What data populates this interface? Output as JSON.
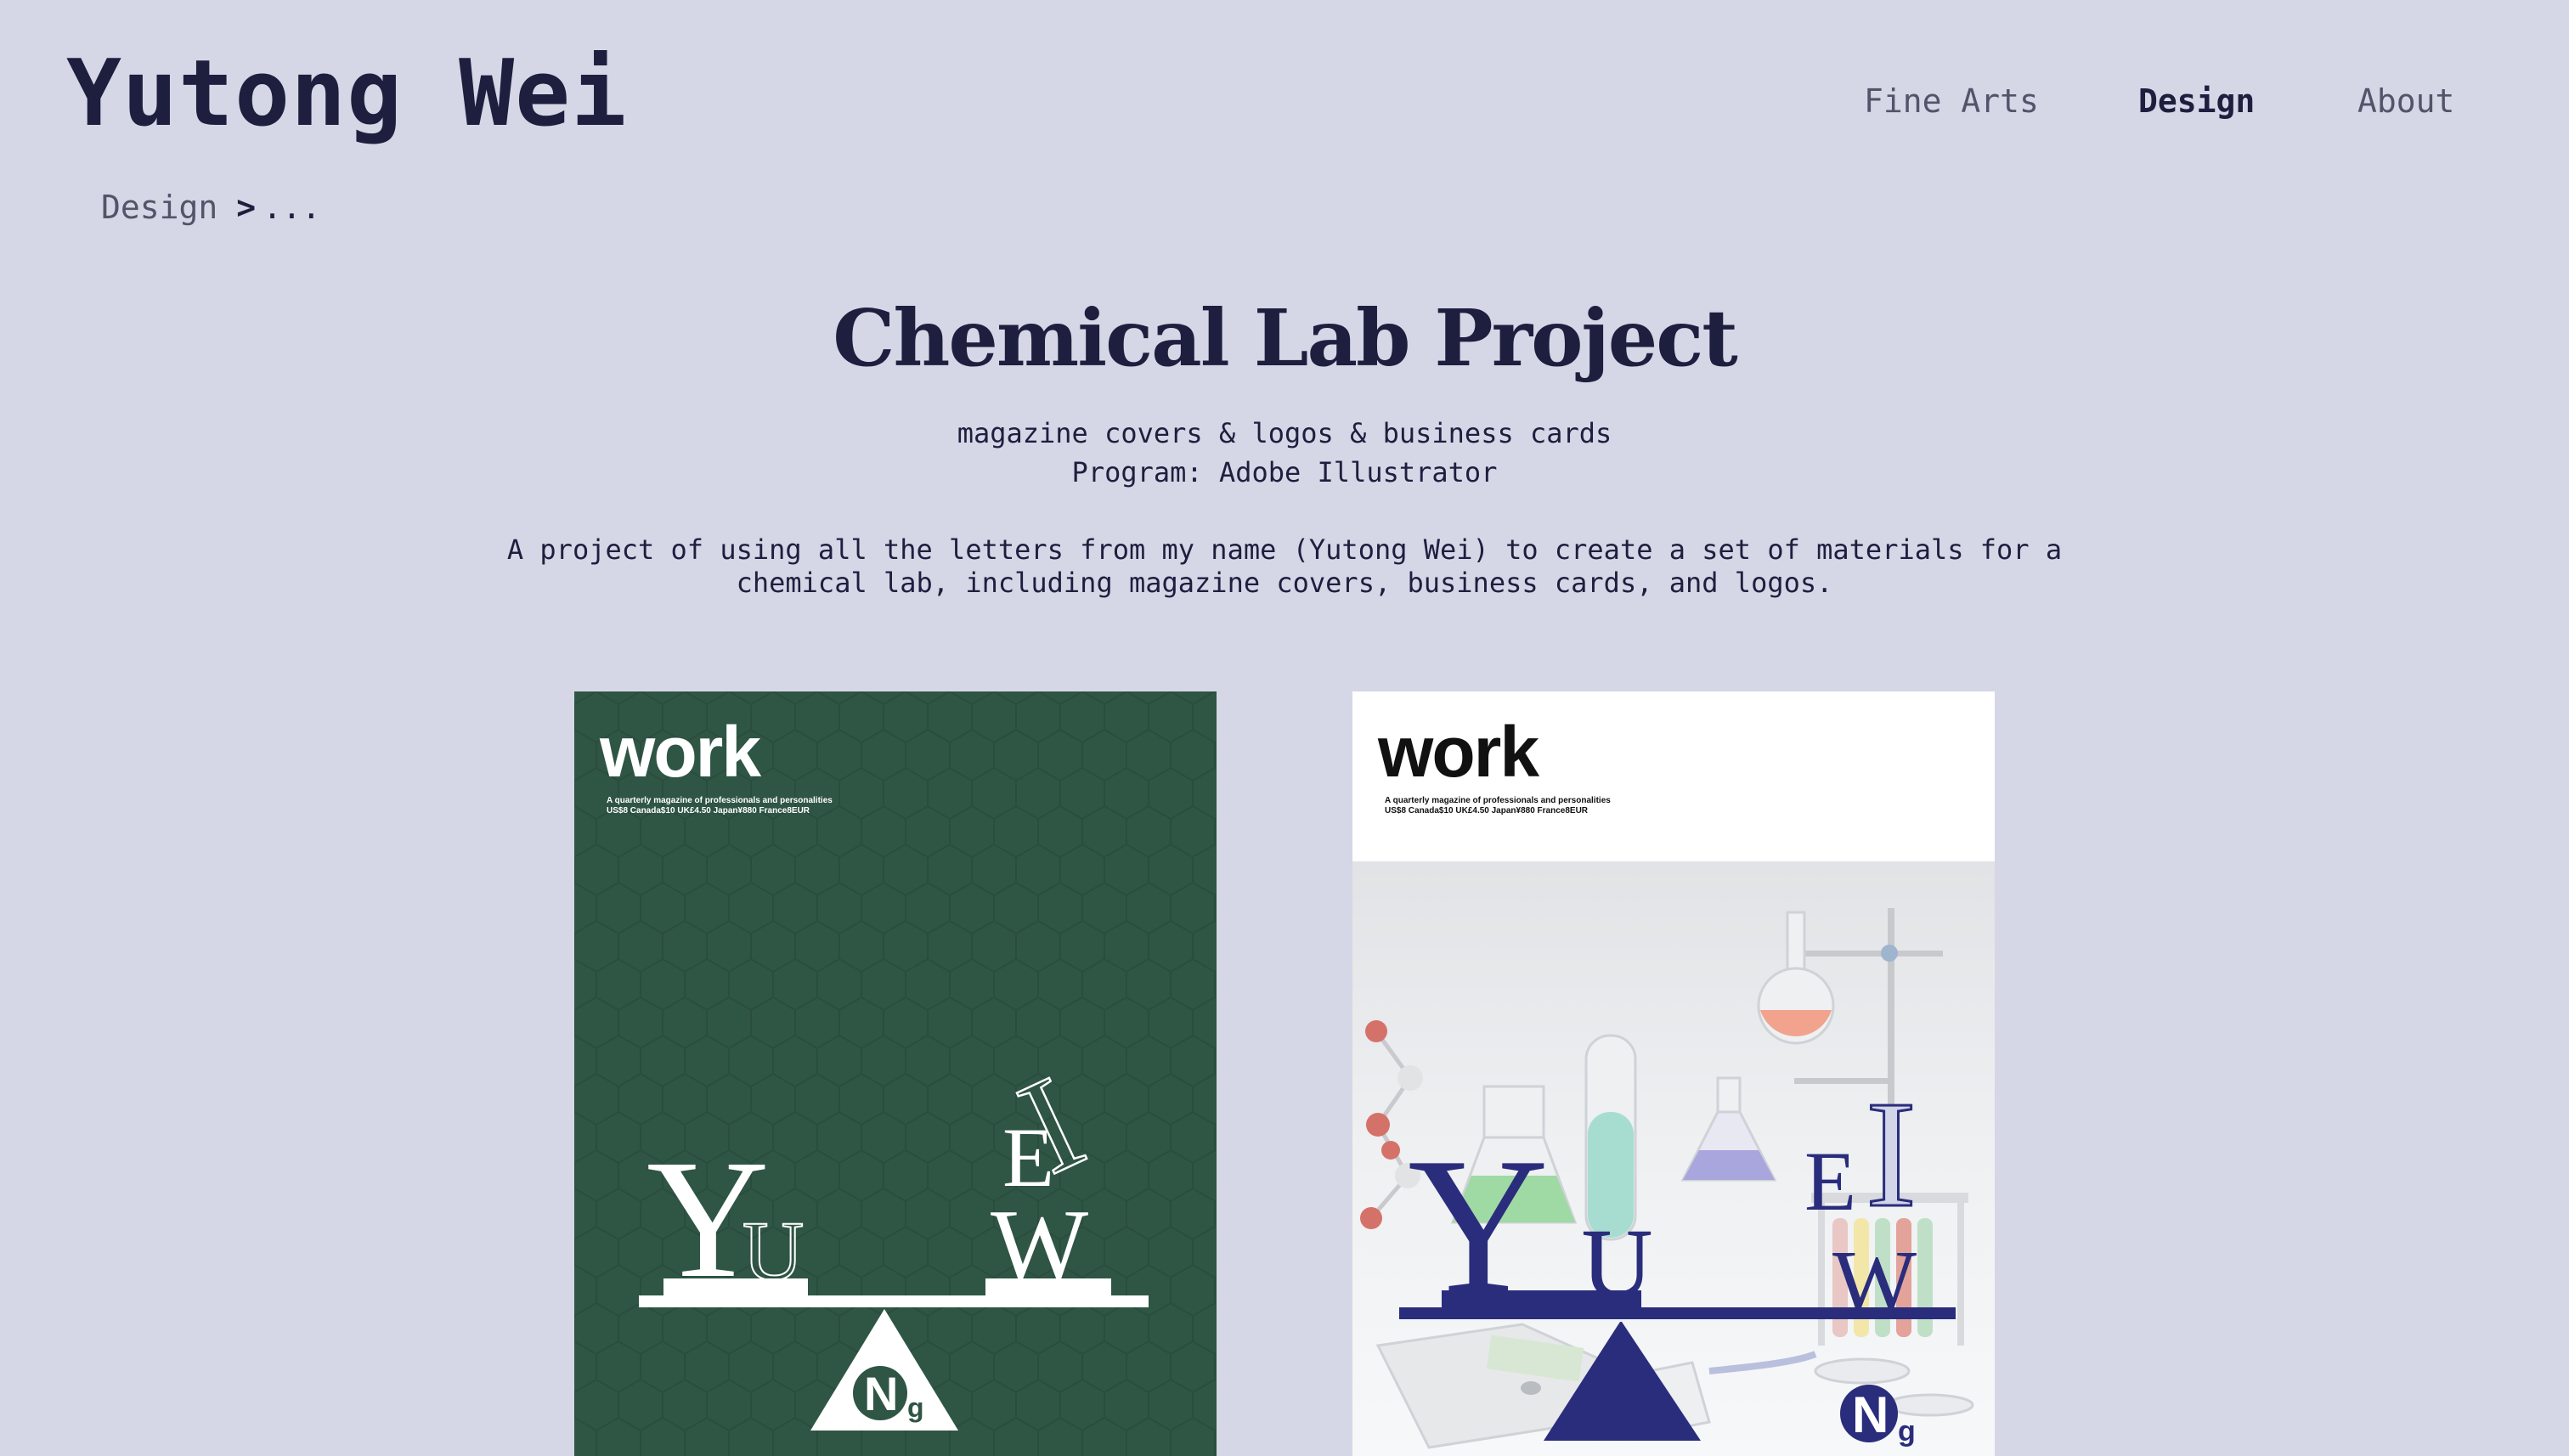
{
  "site": {
    "title": "Yutong Wei"
  },
  "nav": {
    "items": [
      {
        "label": "Fine Arts",
        "active": false
      },
      {
        "label": "Design",
        "active": true
      },
      {
        "label": "About",
        "active": false
      }
    ]
  },
  "breadcrumb": {
    "root": "Design",
    "separator": ">",
    "rest": "..."
  },
  "project": {
    "title": "Chemical Lab Project",
    "subtitle": "magazine covers & logos & business cards",
    "program": "Program: Adobe Illustrator",
    "description": "A project of using all the letters from my name (Yutong Wei) to create a set of materials for a chemical lab, including magazine covers, business cards, and logos."
  },
  "covers": [
    {
      "masthead": "work",
      "tagline": "A quarterly magazine of professionals and personalities",
      "prices": "US$8 Canada$10 UK£4.50 Japan¥880 France8EUR",
      "letters": [
        "Y",
        "U",
        "E",
        "I",
        "W"
      ],
      "logo": {
        "big": "N",
        "small": "g"
      },
      "colors": {
        "background": "#2f5545",
        "ink": "#ffffff"
      }
    },
    {
      "masthead": "work",
      "tagline": "A quarterly magazine of professionals and personalities",
      "prices": "US$8 Canada$10 UK£4.50 Japan¥880 France8EUR",
      "letters": [
        "Y",
        "U",
        "E",
        "I",
        "W"
      ],
      "logo": {
        "big": "N",
        "small": "g"
      },
      "colors": {
        "background": "#ffffff",
        "ink": "#2a2d7c"
      }
    }
  ]
}
